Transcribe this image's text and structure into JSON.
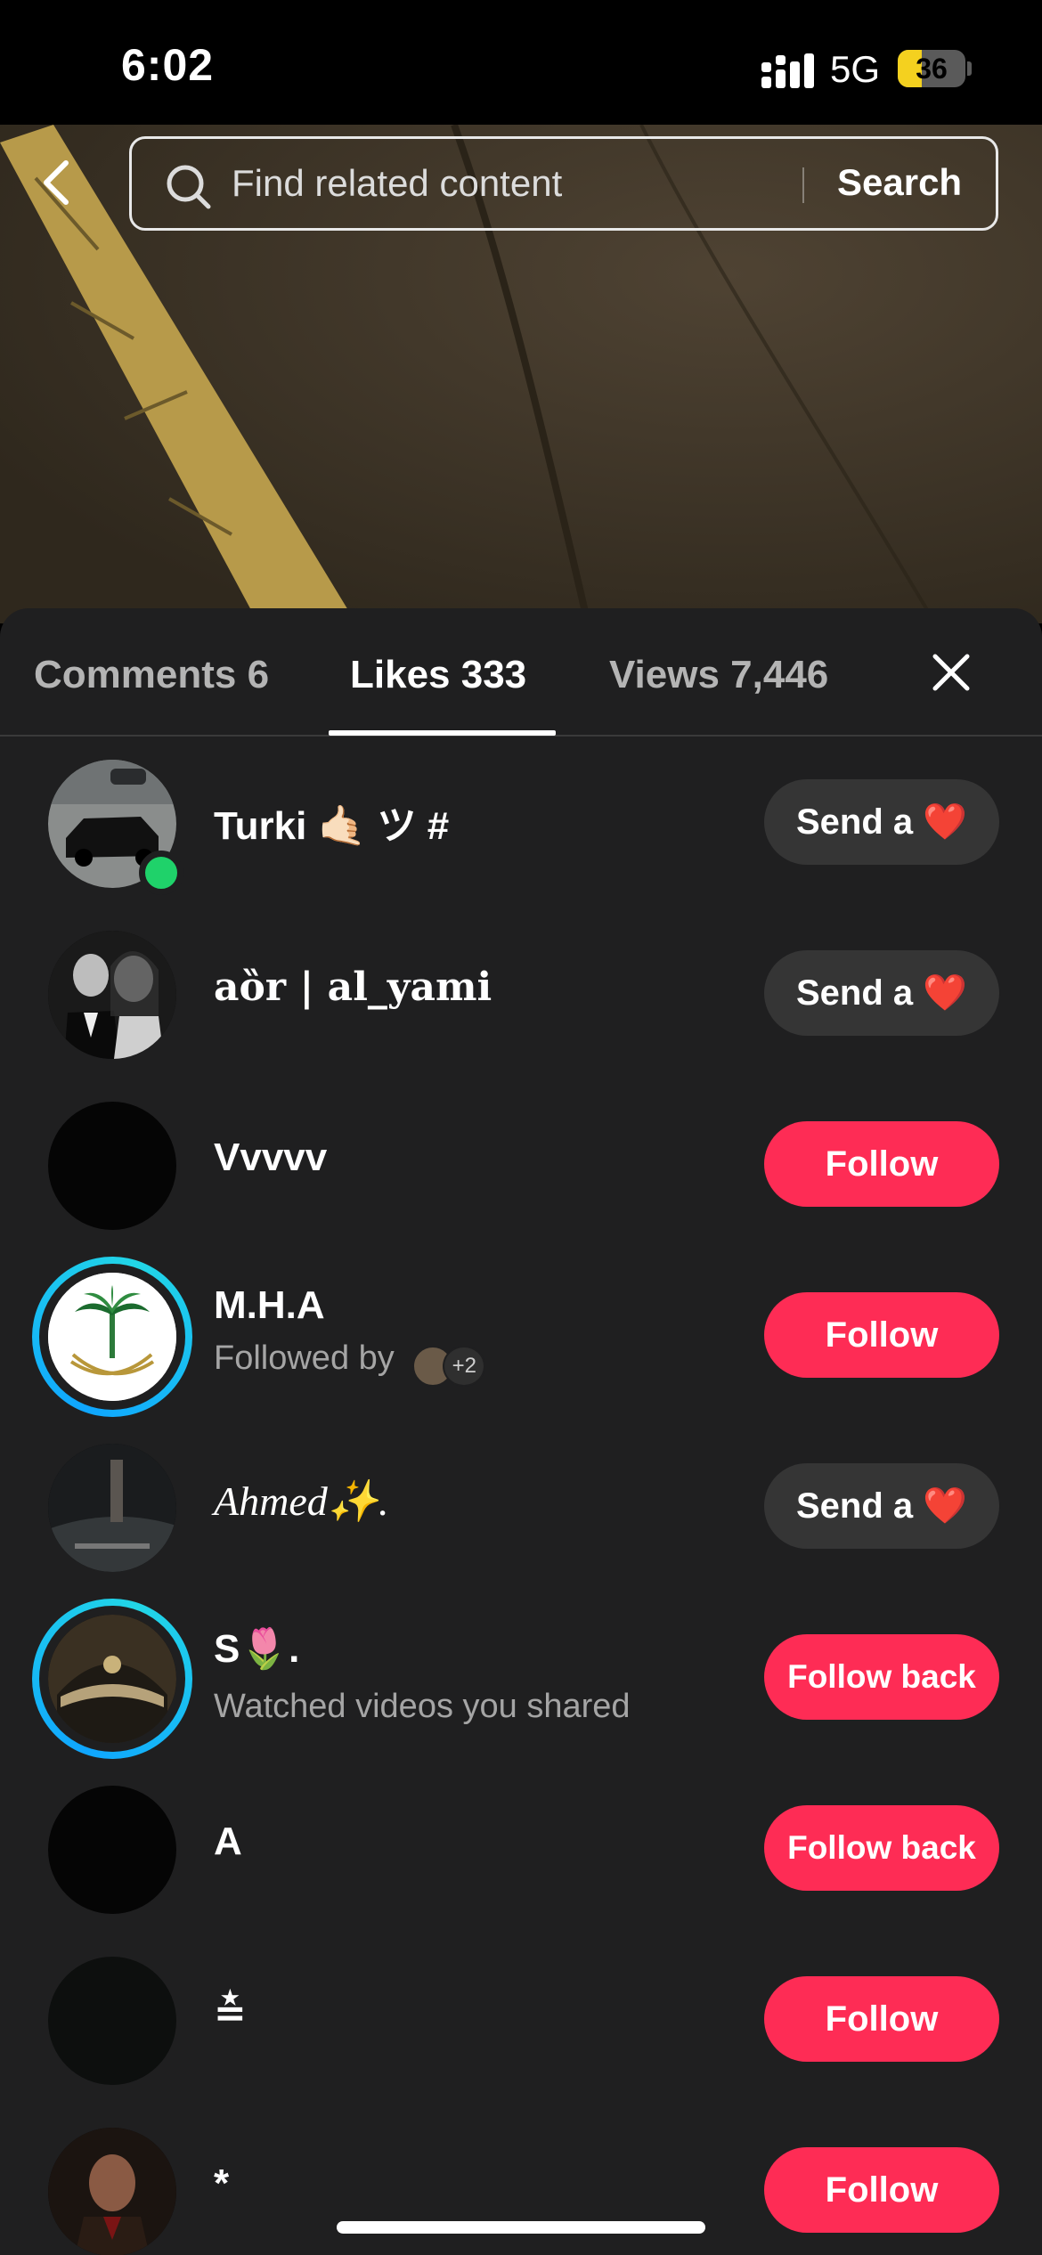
{
  "status_bar": {
    "time": "6:02",
    "network": "5G",
    "battery": "36",
    "battery_level_percent": 36
  },
  "search": {
    "placeholder": "Find related content",
    "button_label": "Search"
  },
  "tabs": {
    "comments": "Comments 6",
    "likes": "Likes 333",
    "views": "Views 7,446",
    "active": "likes"
  },
  "colors": {
    "follow_button": "#fe2c55",
    "send_button": "#353535",
    "sheet_background": "#1f1f20",
    "online_dot": "#1fd26a",
    "story_ring": "#22d6e6"
  },
  "users": [
    {
      "name": "Turki 🤙🏻 ツ #",
      "subtext": "",
      "action": "Send a ❤️",
      "action_type": "send",
      "online": true,
      "story_ring": false
    },
    {
      "name": "aȍr | al_yami",
      "subtext": "",
      "action": "Send a ❤️",
      "action_type": "send",
      "online": false,
      "story_ring": false
    },
    {
      "name": "Vvvvv",
      "subtext": "",
      "action": "Follow",
      "action_type": "follow",
      "online": false,
      "story_ring": false
    },
    {
      "name": "M.H.A",
      "subtext": "Followed by",
      "mutual_more": "+2",
      "action": "Follow",
      "action_type": "follow",
      "online": false,
      "story_ring": true
    },
    {
      "name": "Ahmed✨.",
      "subtext": "",
      "action": "Send a ❤️",
      "action_type": "send",
      "online": false,
      "story_ring": false
    },
    {
      "name": "S🌷.",
      "subtext": "Watched videos you shared",
      "action": "Follow back",
      "action_type": "followback",
      "online": false,
      "story_ring": true
    },
    {
      "name": "A",
      "subtext": "",
      "action": "Follow back",
      "action_type": "followback",
      "online": false,
      "story_ring": false
    },
    {
      "name": "≛",
      "subtext": "",
      "action": "Follow",
      "action_type": "follow",
      "online": false,
      "story_ring": false
    },
    {
      "name": "*",
      "subtext": "",
      "action": "Follow",
      "action_type": "follow",
      "online": false,
      "story_ring": false
    }
  ]
}
